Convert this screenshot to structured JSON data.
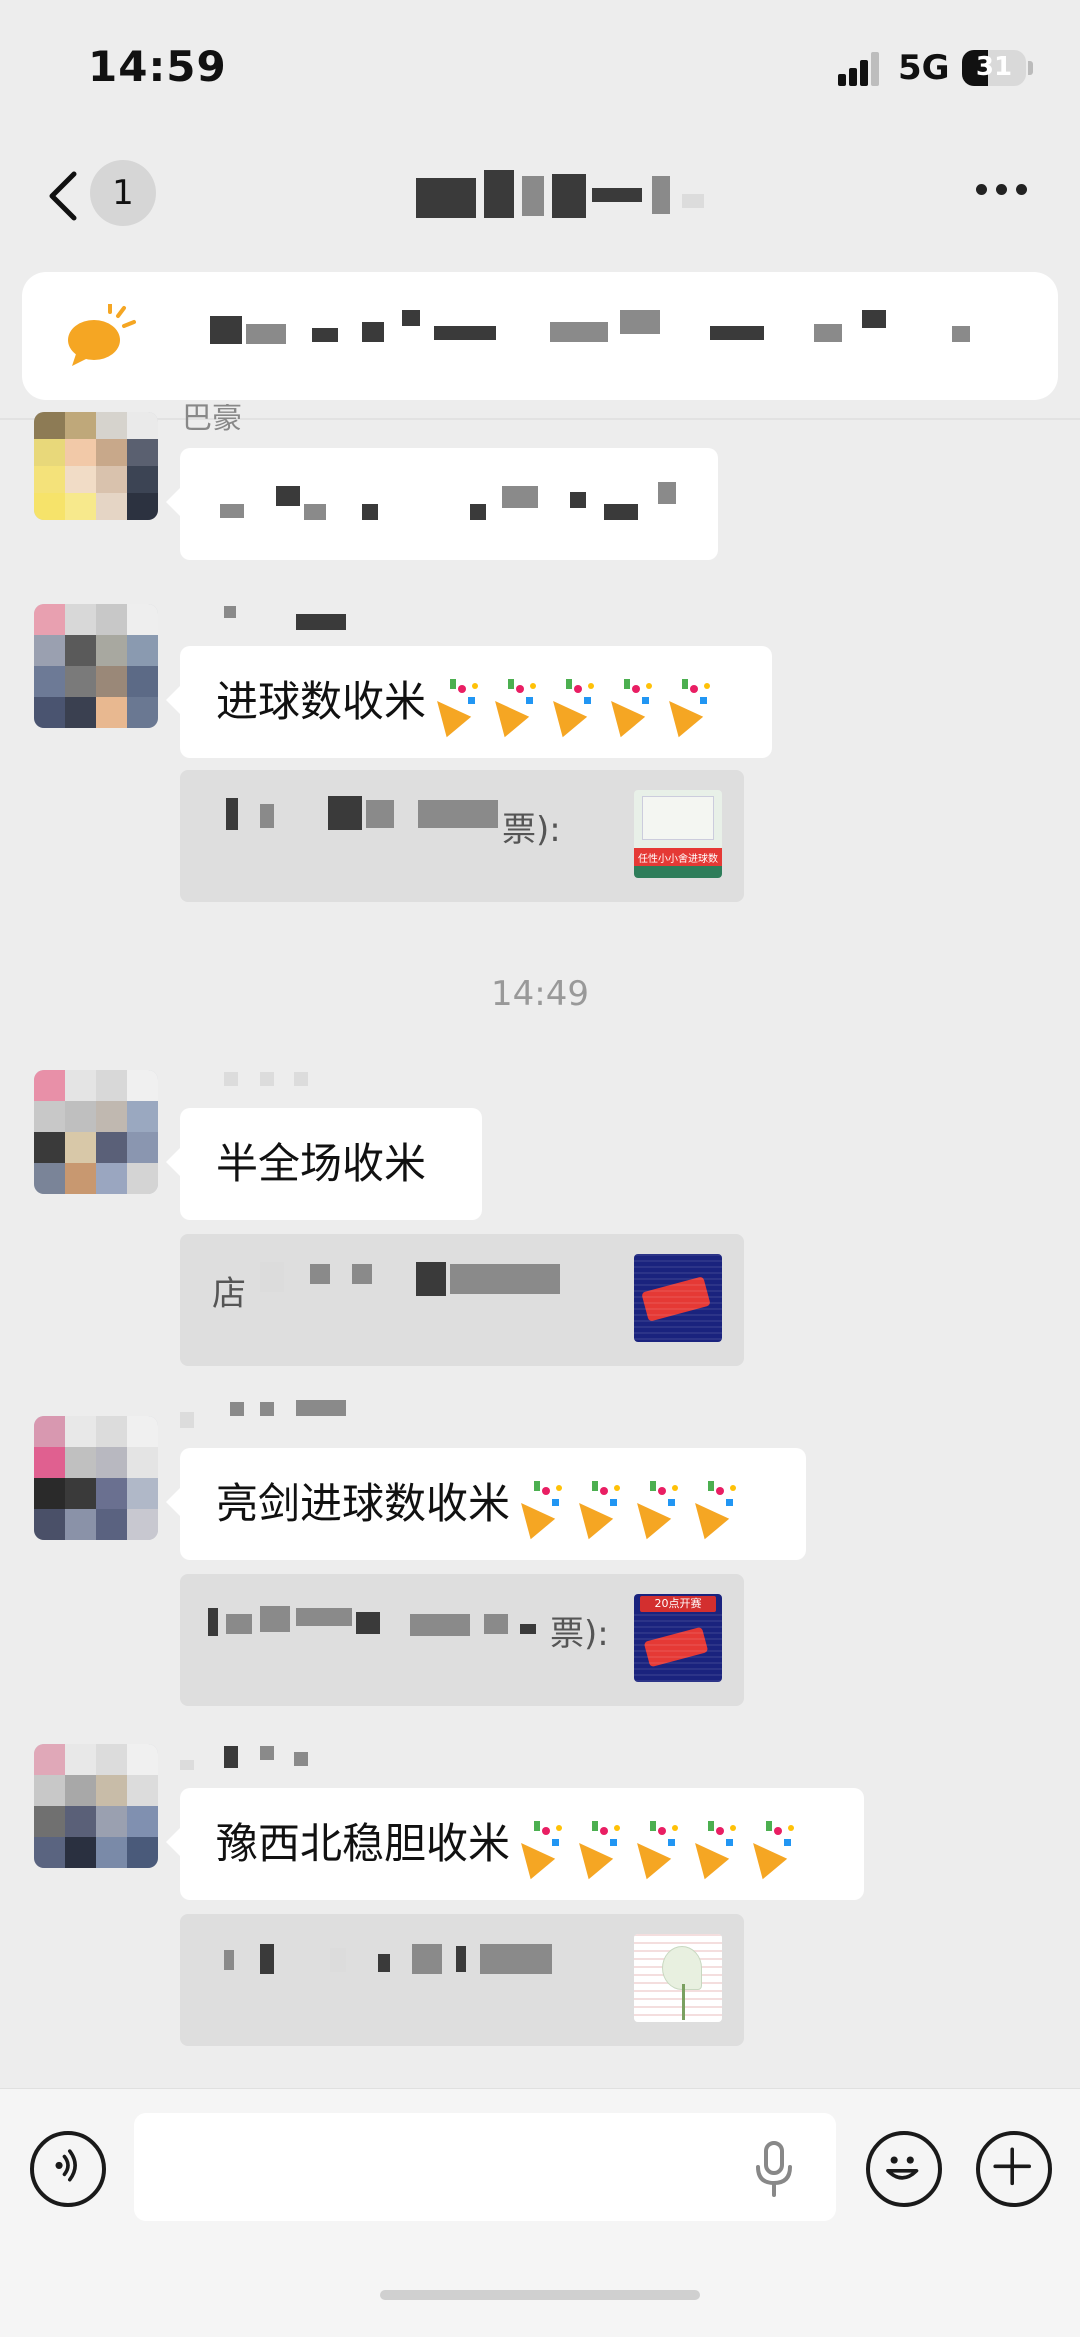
{
  "status_bar": {
    "time": "14:59",
    "network": "5G",
    "battery": "31",
    "battery_level": 0.31
  },
  "nav": {
    "back_badge": "1"
  },
  "timestamp": "14:49",
  "messages": [
    {
      "text": "进球数收米",
      "emoji_count": 5,
      "quote_visible": "票):"
    },
    {
      "text": "半全场收米",
      "emoji_count": 0,
      "quote_visible": "店"
    },
    {
      "text": "亮剑进球数收米",
      "emoji_count": 4,
      "quote_visible": "票):"
    },
    {
      "text": "豫西北稳胆收米",
      "emoji_count": 5,
      "quote_visible": ""
    }
  ],
  "first_message": {
    "name_visible": "巴豪"
  },
  "thumb_labels": {
    "t1": "任性小小舍进球数",
    "t3": "20点开赛"
  },
  "icons": {
    "back": "chevron-left-icon",
    "more": "more-dots-icon",
    "notice": "speech-bubble-icon",
    "voice": "voice-toggle-icon",
    "mic": "microphone-icon",
    "emoji": "emoji-face-icon",
    "plus": "plus-icon"
  },
  "colors": {
    "background": "#ededed",
    "bubble": "#ffffff",
    "quote": "#dedede",
    "notice_icon": "#f5a623"
  }
}
